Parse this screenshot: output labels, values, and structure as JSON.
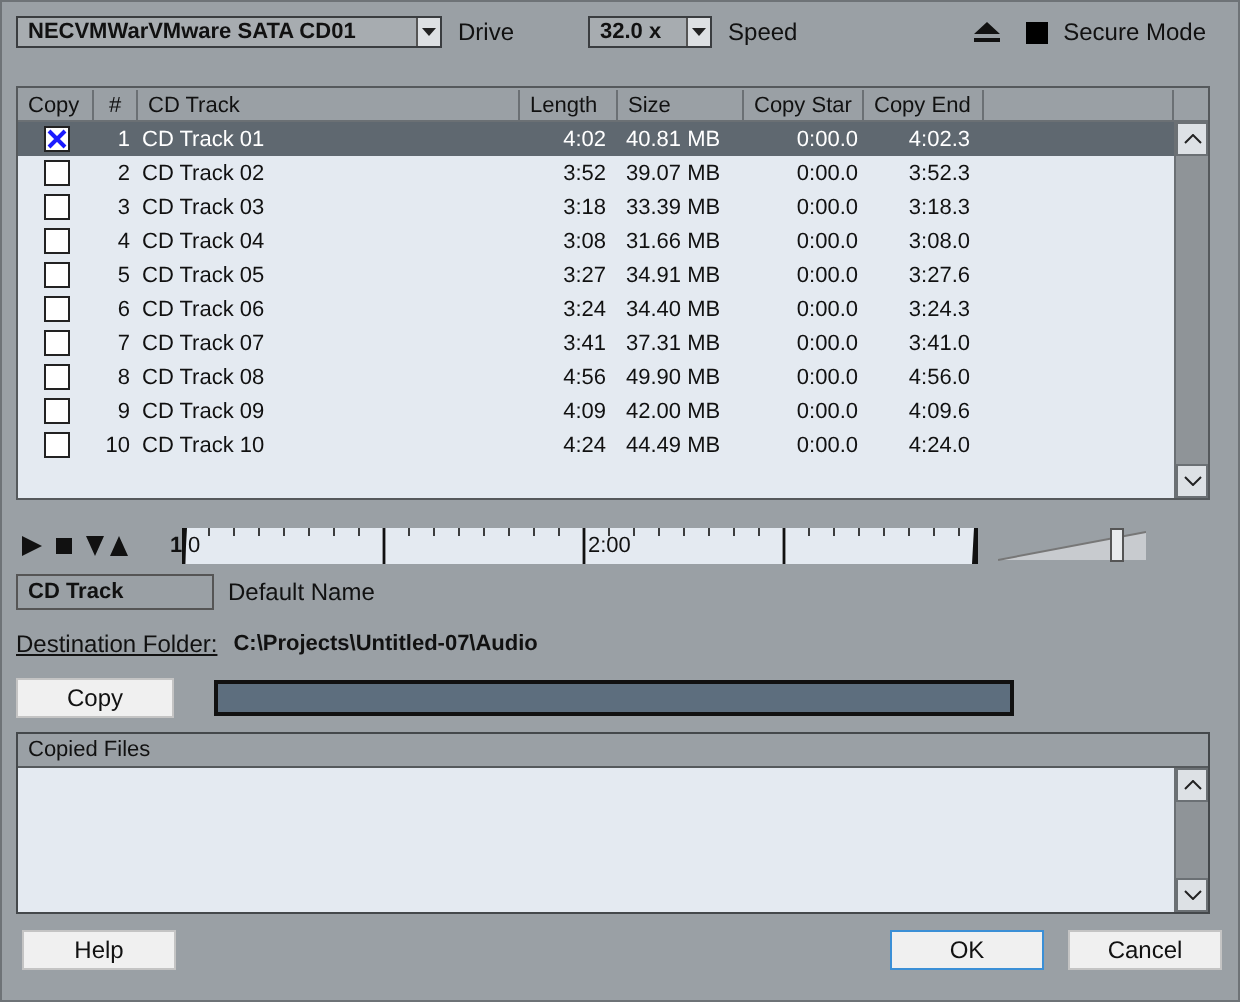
{
  "drive": {
    "value": "NECVMWarVMware SATA CD01",
    "label": "Drive"
  },
  "speed": {
    "value": "32.0 x",
    "label": "Speed"
  },
  "secure_mode": {
    "label": "Secure Mode",
    "checked": false
  },
  "table": {
    "columns": [
      "Copy",
      "#",
      "CD Track",
      "Length",
      "Size",
      "Copy Star",
      "Copy End"
    ],
    "rows": [
      {
        "checked": true,
        "selected": true,
        "cells": [
          "",
          "1",
          "CD Track 01",
          "4:02",
          "40.81 MB",
          "0:00.0",
          "4:02.3"
        ]
      },
      {
        "checked": false,
        "selected": false,
        "cells": [
          "",
          "2",
          "CD Track 02",
          "3:52",
          "39.07 MB",
          "0:00.0",
          "3:52.3"
        ]
      },
      {
        "checked": false,
        "selected": false,
        "cells": [
          "",
          "3",
          "CD Track 03",
          "3:18",
          "33.39 MB",
          "0:00.0",
          "3:18.3"
        ]
      },
      {
        "checked": false,
        "selected": false,
        "cells": [
          "",
          "4",
          "CD Track 04",
          "3:08",
          "31.66 MB",
          "0:00.0",
          "3:08.0"
        ]
      },
      {
        "checked": false,
        "selected": false,
        "cells": [
          "",
          "5",
          "CD Track 05",
          "3:27",
          "34.91 MB",
          "0:00.0",
          "3:27.6"
        ]
      },
      {
        "checked": false,
        "selected": false,
        "cells": [
          "",
          "6",
          "CD Track 06",
          "3:24",
          "34.40 MB",
          "0:00.0",
          "3:24.3"
        ]
      },
      {
        "checked": false,
        "selected": false,
        "cells": [
          "",
          "7",
          "CD Track 07",
          "3:41",
          "37.31 MB",
          "0:00.0",
          "3:41.0"
        ]
      },
      {
        "checked": false,
        "selected": false,
        "cells": [
          "",
          "8",
          "CD Track 08",
          "4:56",
          "49.90 MB",
          "0:00.0",
          "4:56.0"
        ]
      },
      {
        "checked": false,
        "selected": false,
        "cells": [
          "",
          "9",
          "CD Track 09",
          "4:09",
          "42.00 MB",
          "0:00.0",
          "4:09.6"
        ]
      },
      {
        "checked": false,
        "selected": false,
        "cells": [
          "",
          "10",
          "CD Track 10",
          "4:24",
          "44.49 MB",
          "0:00.0",
          "4:24.0"
        ]
      }
    ]
  },
  "transport": {
    "marker": "1",
    "ruler_labels": [
      "0",
      "2:00"
    ],
    "volume": {
      "level": 0.83
    }
  },
  "name": {
    "value": "CD Track",
    "label": "Default Name"
  },
  "destination": {
    "label": "Destination Folder:",
    "path": "C:\\Projects\\Untitled-07\\Audio"
  },
  "copy_button": "Copy",
  "progress": {
    "level": 0
  },
  "copied_files": {
    "title": "Copied Files"
  },
  "buttons": [
    {
      "label": "Help",
      "default": false
    },
    {
      "label": "OK",
      "default": true
    },
    {
      "label": "Cancel",
      "default": false
    }
  ]
}
